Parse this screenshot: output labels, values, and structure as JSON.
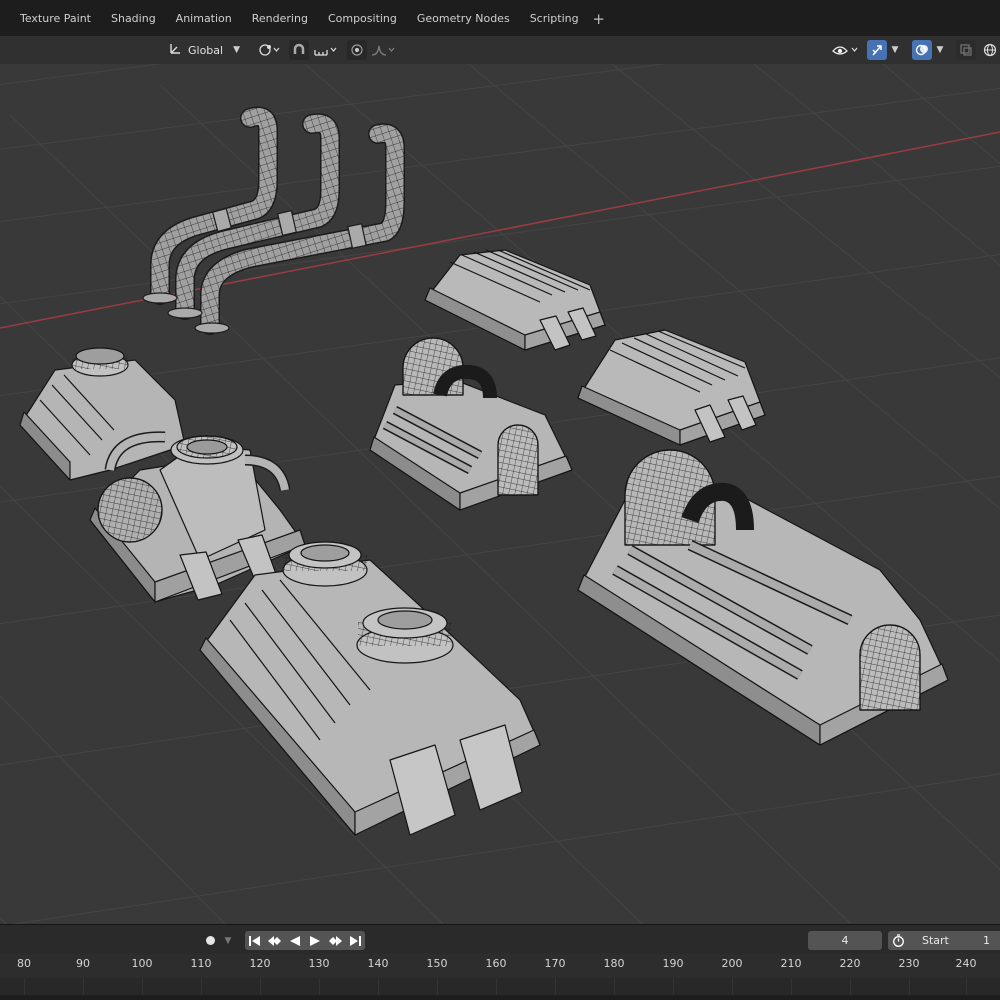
{
  "workspace_tabs": [
    "Texture Paint",
    "Shading",
    "Animation",
    "Rendering",
    "Compositing",
    "Geometry Nodes",
    "Scripting"
  ],
  "add_workspace_label": "+",
  "viewport_header": {
    "transform_orientation": "Global",
    "icons": [
      "transform-orientation-icon",
      "pivot-icon",
      "snap-icon",
      "snap-increment-icon",
      "proportional-edit-icon",
      "falloff-icon",
      "visibility-icon",
      "gizmo-icon",
      "overlay-icon",
      "xray-icon",
      "shading-wireframe-icon"
    ]
  },
  "colors": {
    "topbar": "#1d1d1d",
    "viewport_bg": "#393939",
    "grid": "#444444",
    "x_axis": "#9b3b44",
    "mesh_face": "#b9b9b9",
    "mesh_edge": "#151515",
    "accent_blue": "#4772b3"
  },
  "scene_objects": [
    "exhaust-pipes-asset",
    "small-block-asset",
    "medium-block-asset",
    "left-tank-block-asset",
    "round-tank-machine-asset",
    "dome-generator-asset",
    "twin-vent-block-asset",
    "large-dome-generator-asset"
  ],
  "timeline": {
    "current_frame": "4",
    "start_label": "Start",
    "start_value": "1",
    "ruler_labels": [
      "80",
      "90",
      "100",
      "110",
      "120",
      "130",
      "140",
      "150",
      "160",
      "170",
      "180",
      "190",
      "200",
      "210",
      "220",
      "230",
      "240"
    ]
  }
}
